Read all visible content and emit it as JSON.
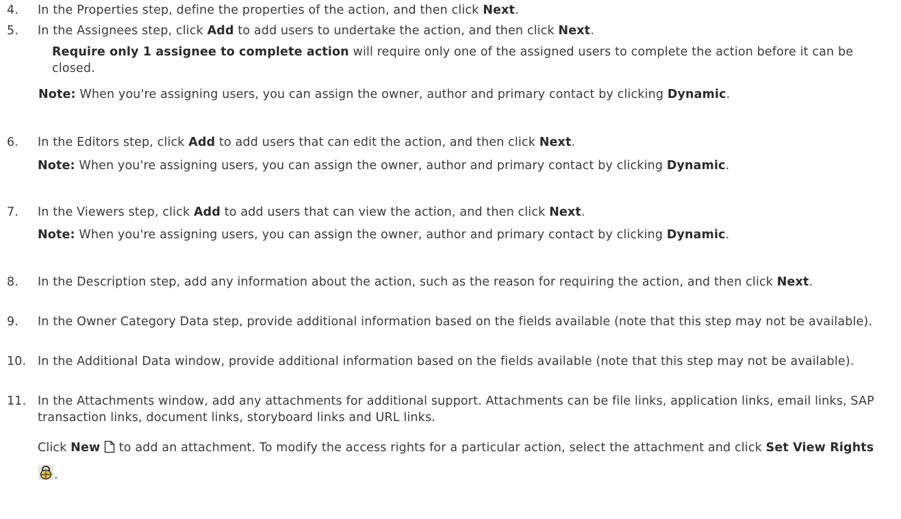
{
  "steps": [
    {
      "num": "4.",
      "a": "In the Properties step, define the properties of the action, and then click ",
      "b1": "Next",
      "c": "."
    },
    {
      "num": "5.",
      "a": "In the Assignees step, click ",
      "b1": "Add",
      "c": " to add users to undertake the action, and then click ",
      "b2": "Next",
      "d": "."
    },
    {
      "num": "6.",
      "a": "In the Editors step, click ",
      "b1": "Add",
      "c": " to add users that can edit the action, and then click ",
      "b2": "Next",
      "d": "."
    },
    {
      "num": "7.",
      "a": "In the Viewers step, click ",
      "b1": "Add",
      "c": " to add users that can view the action, and then click ",
      "b2": "Next",
      "d": "."
    },
    {
      "num": "8.",
      "a": "In the Description step, add any information about the action, such as the reason for requiring the action, and then click ",
      "b1": "Next",
      "c": "."
    },
    {
      "num": "9.",
      "a": "In the Owner Category Data step, provide additional information based on the fields available (note that this step may not be available)."
    },
    {
      "num": "10.",
      "a": "In the Additional Data window, provide additional information based on the fields available (note that this step may not be available)."
    },
    {
      "num": "11.",
      "a": "In the Attachments window, add any attachments for additional support. Attachments can be file links, application links, email links, SAP transaction links, document links, storyboard links and URL links."
    }
  ],
  "require_note": {
    "bold": "Require only 1 assignee to complete action",
    "text": " will require only one of the assigned users to complete the action before it can be closed."
  },
  "note": {
    "label": "Note:",
    "text": " When you're assigning users, you can assign the owner, author and primary contact by clicking ",
    "bold": "Dynamic",
    "end": "."
  },
  "attach_para": {
    "a": "Click ",
    "new_label": "New",
    "b": " to add an attachment. To modify the access rights for a particular action, select the attachment and click ",
    "rights_label": "Set View Rights",
    "c": "."
  },
  "icons": {
    "new": "new-document-icon",
    "rights": "lock-icon"
  }
}
